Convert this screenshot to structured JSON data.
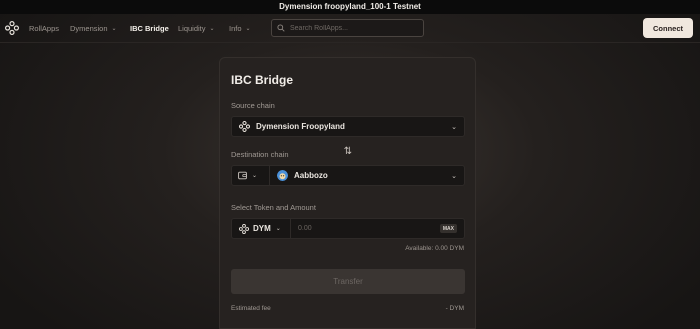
{
  "banner": {
    "text": "Dymension froopyland_100-1 Testnet"
  },
  "nav": {
    "logo_icon": "dymension-logo-icon",
    "items": [
      {
        "label": "RollApps",
        "has_dropdown": false,
        "active": false
      },
      {
        "label": "Dymension",
        "has_dropdown": true,
        "active": false
      },
      {
        "label": "IBC Bridge",
        "has_dropdown": false,
        "active": true
      },
      {
        "label": "Liquidity",
        "has_dropdown": true,
        "active": false
      },
      {
        "label": "Info",
        "has_dropdown": true,
        "active": false
      }
    ],
    "search": {
      "placeholder": "Search RollApps...",
      "value": "",
      "icon": "search-icon"
    },
    "connect_label": "Connect"
  },
  "bridge": {
    "title": "IBC Bridge",
    "source": {
      "label": "Source chain",
      "selected": "Dymension Froopyland",
      "icon": "dymension-logo-icon"
    },
    "swap_icon": "swap-arrows-icon",
    "destination": {
      "label": "Destination chain",
      "wallet_icon": "wallet-icon",
      "selected": "Aabbozo",
      "icon": "aabbozo-avatar-icon"
    },
    "token": {
      "label": "Select Token and Amount",
      "selected": "DYM",
      "amount_placeholder": "0.00",
      "max_label": "MAX",
      "available": "Available: 0.00 DYM"
    },
    "transfer_label": "Transfer",
    "fee": {
      "label": "Estimated fee",
      "value": "- DYM"
    }
  },
  "colors": {
    "background": "#1a1716",
    "card": "#262220",
    "accent_button": "#f0e7de",
    "text": "#e8e3dc"
  }
}
